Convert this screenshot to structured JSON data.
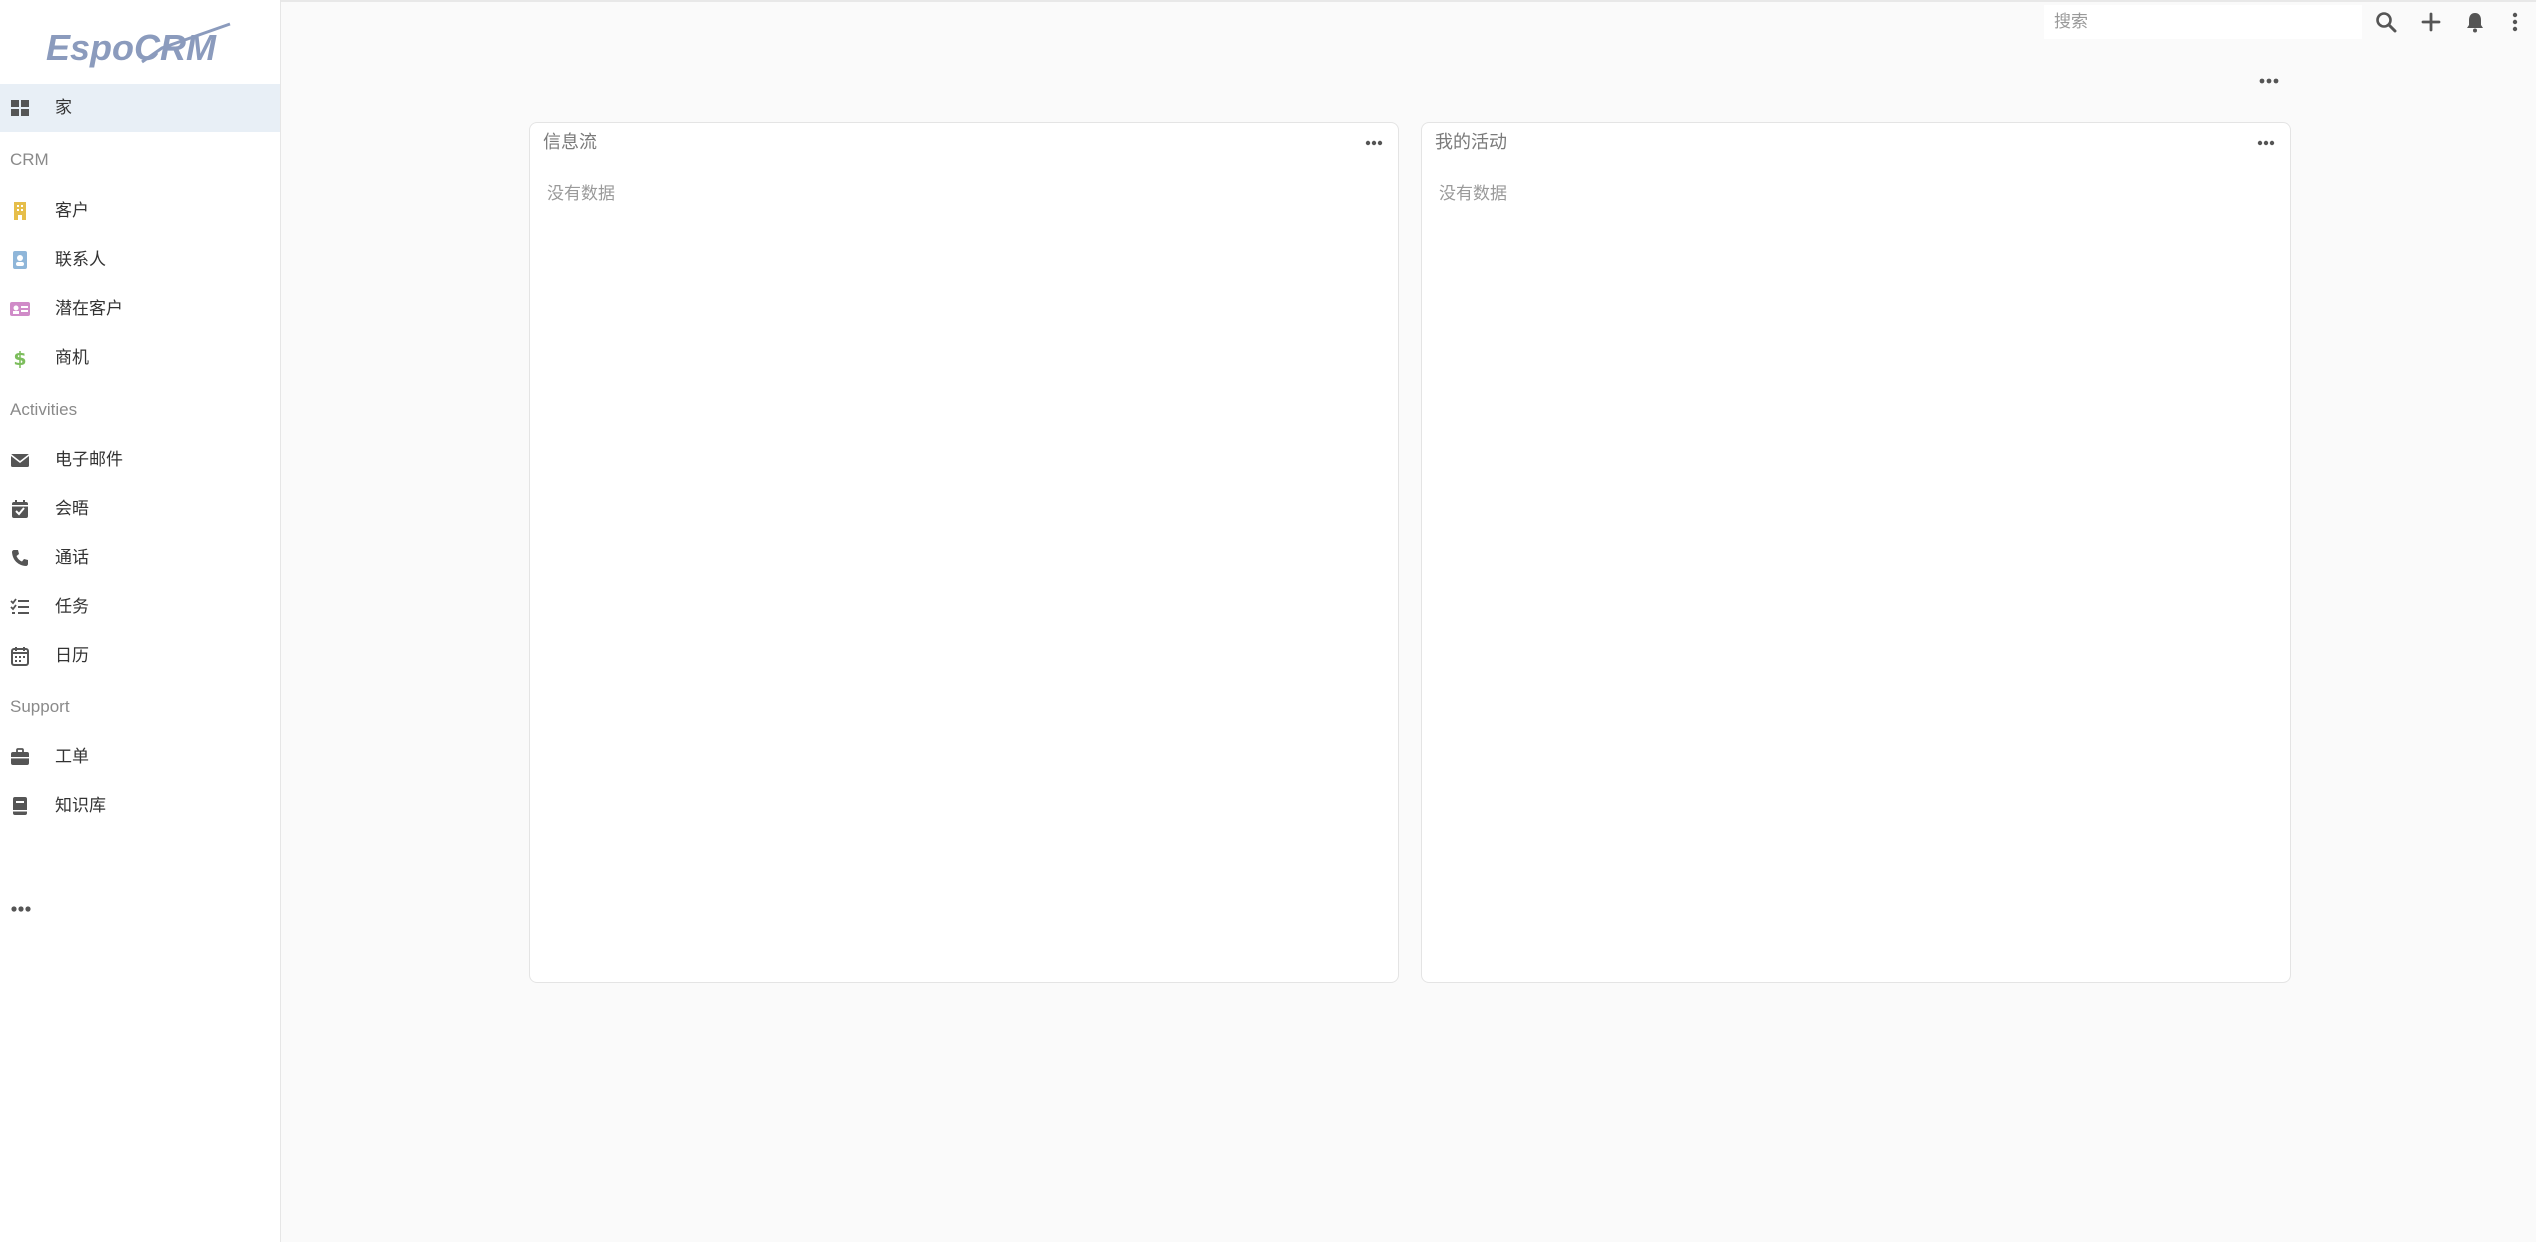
{
  "app": {
    "logo_text": "EspoCRM"
  },
  "colors": {
    "accent": "#8b9bbd",
    "active_bg": "#e8eff6"
  },
  "sidebar": {
    "home": {
      "label": "家",
      "icon": "dashboard-grid-icon"
    },
    "sections": [
      {
        "title": "CRM",
        "items": [
          {
            "label": "客户",
            "icon": "building-icon",
            "color": "#e6be4a"
          },
          {
            "label": "联系人",
            "icon": "contact-card-icon",
            "color": "#8fb6d9"
          },
          {
            "label": "潜在客户",
            "icon": "id-card-icon",
            "color": "#d08bc8"
          },
          {
            "label": "商机",
            "icon": "dollar-icon",
            "color": "#7cbd5c"
          }
        ]
      },
      {
        "title": "Activities",
        "items": [
          {
            "label": "电子邮件",
            "icon": "envelope-icon"
          },
          {
            "label": "会晤",
            "icon": "calendar-check-icon"
          },
          {
            "label": "通话",
            "icon": "phone-icon"
          },
          {
            "label": "任务",
            "icon": "task-list-icon"
          },
          {
            "label": "日历",
            "icon": "calendar-icon"
          }
        ]
      },
      {
        "title": "Support",
        "items": [
          {
            "label": "工单",
            "icon": "briefcase-icon"
          },
          {
            "label": "知识库",
            "icon": "book-icon"
          }
        ]
      }
    ]
  },
  "topbar": {
    "search_placeholder": "搜索"
  },
  "dashlets": [
    {
      "title": "信息流",
      "empty_text": "没有数据"
    },
    {
      "title": "我的活动",
      "empty_text": "没有数据"
    }
  ]
}
